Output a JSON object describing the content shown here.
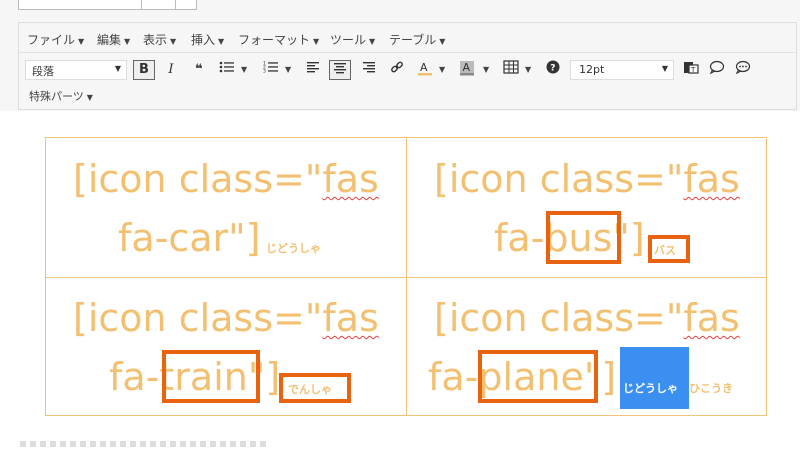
{
  "menubar": {
    "items": [
      {
        "label": "ファイル"
      },
      {
        "label": "編集"
      },
      {
        "label": "表示"
      },
      {
        "label": "挿入"
      },
      {
        "label": "フォーマット"
      },
      {
        "label": "ツール"
      },
      {
        "label": "テーブル"
      }
    ]
  },
  "toolbar": {
    "format_value": "段落",
    "bold": "B",
    "italic": "I",
    "blockquote": "❝",
    "font_size": "12pt",
    "special_label": "特殊パーツ"
  },
  "cells": [
    {
      "line1": "[icon class=\"",
      "line1_err": "fas",
      "line2": "fa-car\"]",
      "ruby": "じどうしゃ"
    },
    {
      "line1": "[icon class=\"",
      "line1_err": "fas",
      "line2_pre": "fa-",
      "line2_box": "bus",
      "line2_post": "\"]",
      "ruby": "バス"
    },
    {
      "line1": "[icon class=\"",
      "line1_err": "fas",
      "line2_pre": "fa-",
      "line2_box": "train",
      "line2_post": "\"]",
      "ruby": "でんしゃ"
    },
    {
      "line1": "[icon class=\"",
      "line1_err": "fas",
      "line2_pre": "fa-",
      "line2_box": "plane",
      "line2_post": "\"]",
      "ruby_selected": "じどうしゃ",
      "ruby": "ひこうき"
    }
  ],
  "colors": {
    "text": "#f2c070",
    "box": "#e8620f",
    "selection": "#3a8ff0",
    "table_border": "#f1c27a"
  }
}
